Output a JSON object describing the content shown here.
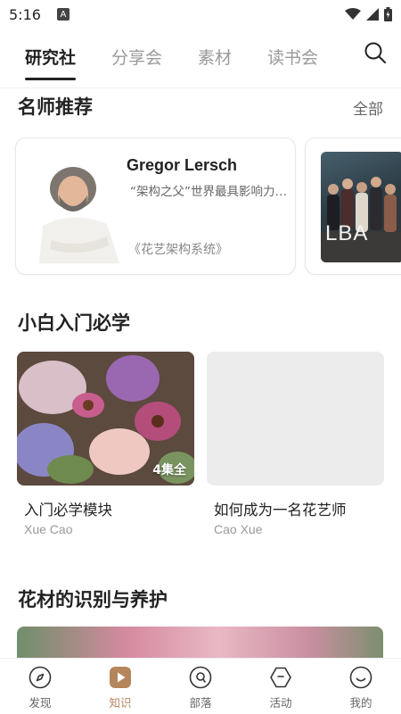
{
  "status_bar": {
    "time": "5:16",
    "indicator_letter": "A"
  },
  "tabs": [
    {
      "label": "研究社",
      "active": true
    },
    {
      "label": "分享会",
      "active": false
    },
    {
      "label": "素材",
      "active": false
    },
    {
      "label": "读书会",
      "active": false
    }
  ],
  "teachers_section": {
    "title": "名师推荐",
    "see_all": "全部",
    "cards": [
      {
        "name": "Gregor Lersch",
        "desc": "“架构之父”世界最具影响力的花艺大师",
        "book": "《花艺架构系统》"
      },
      {
        "logo_text": "LBA"
      }
    ]
  },
  "beginner_section": {
    "title": "小白入门必学",
    "courses": [
      {
        "title": "入门必学模块",
        "author": "Xue Cao",
        "episodes": "4集全"
      },
      {
        "title": "如何成为一名花艺师",
        "author": "Cao Xue"
      }
    ]
  },
  "flower_section": {
    "title": "花材的识别与养护"
  },
  "bottom_nav": [
    {
      "label": "发现",
      "icon": "compass-icon",
      "active": false
    },
    {
      "label": "知识",
      "icon": "play-icon",
      "active": true
    },
    {
      "label": "部落",
      "icon": "tribe-icon",
      "active": false
    },
    {
      "label": "活动",
      "icon": "hexagon-icon",
      "active": false
    },
    {
      "label": "我的",
      "icon": "smile-icon",
      "active": false
    }
  ],
  "colors": {
    "accent": "#b5865c",
    "text": "#222222",
    "muted": "#9a9a9a"
  }
}
